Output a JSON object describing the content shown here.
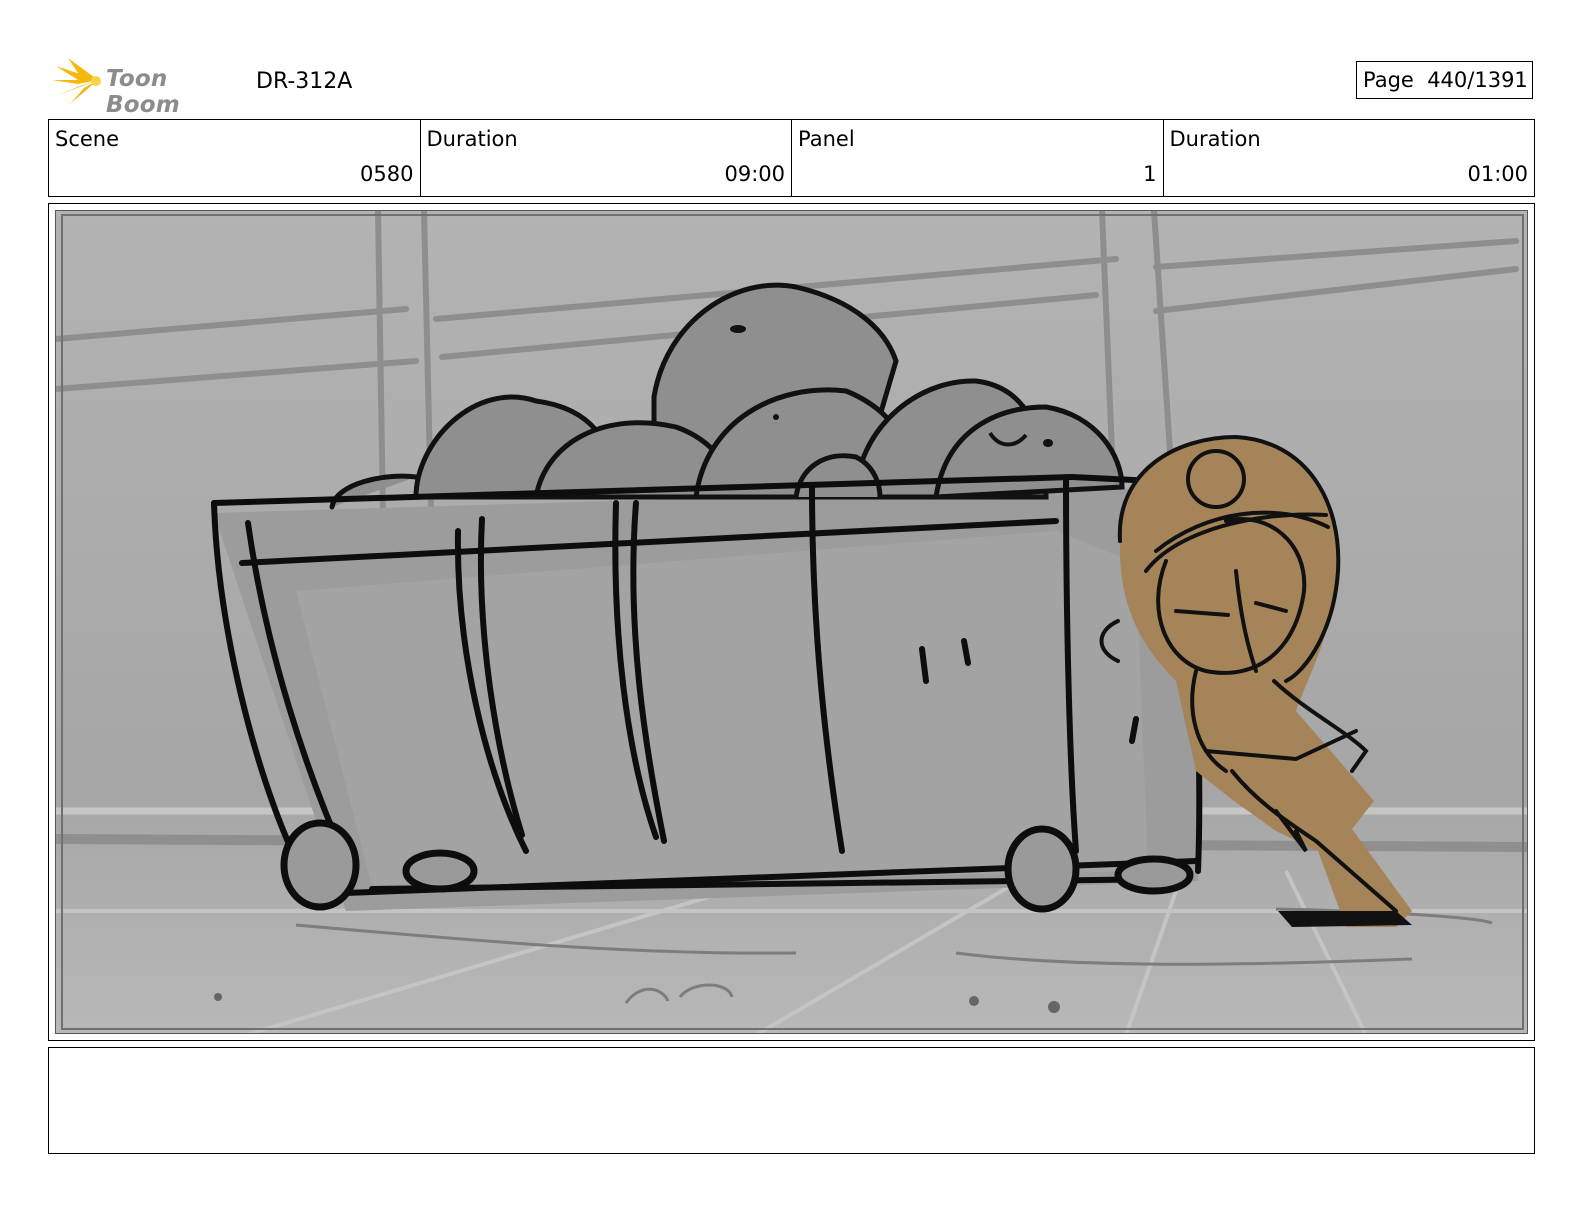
{
  "header": {
    "logo_text": "Toon Boom",
    "project_code": "DR-312A",
    "page_label": "Page  440/1391"
  },
  "info": {
    "scene_label": "Scene",
    "scene_value": "0580",
    "scene_duration_label": "Duration",
    "scene_duration_value": "09:00",
    "panel_label": "Panel",
    "panel_value": "1",
    "panel_duration_label": "Duration",
    "panel_duration_value": "01:00"
  },
  "colors": {
    "logo_star": "#f5b80f",
    "character_fill": "#a6845a",
    "background_gray": "#a8a8a8"
  }
}
